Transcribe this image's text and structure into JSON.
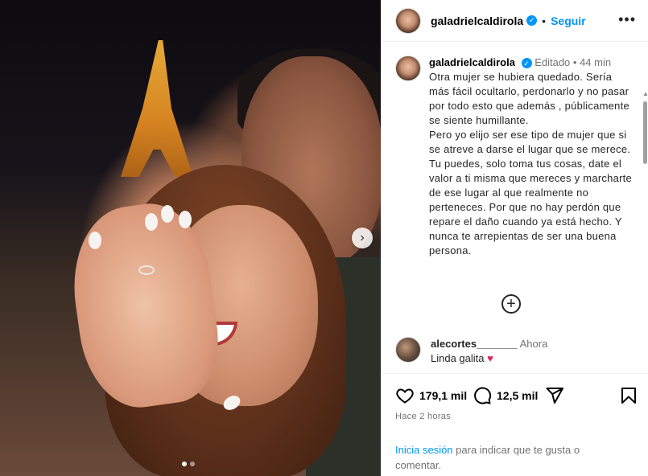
{
  "post": {
    "username": "galadrielcaldirola",
    "follow_label": "Seguir",
    "separator": "•",
    "more_label": "•••"
  },
  "caption": {
    "username": "galadrielcaldirola",
    "edited_label": "Editado",
    "time_label": "44 min",
    "text": "Otra mujer se hubiera quedado. Sería más fácil ocultarlo, perdonarlo y no pasar por todo esto que además , públicamente se siente humillante.\nPero yo elijo ser ese tipo de mujer que si se  atreve a darse el lugar que se merece.\nTu puedes, solo toma tus cosas, date  el valor a ti misma que mereces y marcharte de ese lugar al que realmente no perteneces. Por que no hay  perdón que repare el daño cuando ya está hecho. Y nunca te arrepientas de ser una buena persona."
  },
  "comment": {
    "username": "alecortes_______",
    "time_label": "Ahora",
    "text": "Linda galita",
    "emoji": "♥"
  },
  "actions": {
    "likes": "179,1 mil",
    "comments": "12,5 mil",
    "posted_ago": "Hace 2 horas"
  },
  "login_prompt": {
    "link_text": "Inicia sesión",
    "rest_text": " para indicar que te gusta o comentar."
  },
  "carousel": {
    "slides": 2,
    "active": 1
  },
  "colors": {
    "accent": "#0095f6",
    "muted": "#737373",
    "heart": "#e0245e"
  }
}
